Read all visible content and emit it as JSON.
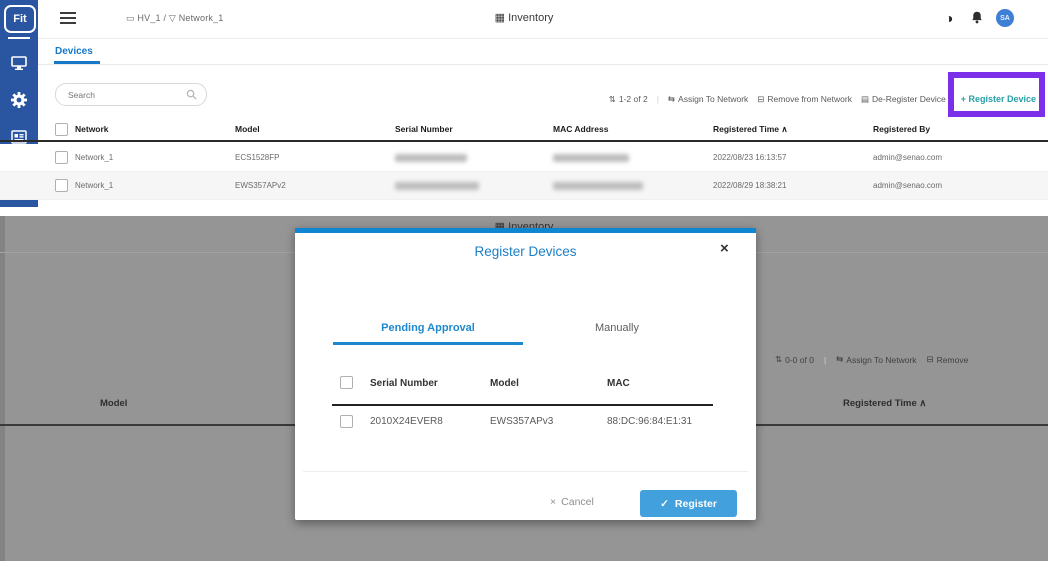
{
  "icons": {
    "sort": "⇅",
    "assign": "⇆",
    "remove": "⊟",
    "deregister": "▤",
    "contrast": "◑",
    "inventory": "▦",
    "breadcrumb_org": "▭",
    "breadcrumb_net": "▽",
    "check": "✓",
    "close": "×",
    "cancel_x": "×",
    "caret_up": "∧",
    "separator": "|"
  },
  "colors": {
    "sidebar_blue": "#2a55a0",
    "tab_blue": "#1878c8",
    "register_teal": "#269fa8",
    "highlight_purple": "#7c2fe8",
    "modal_blue": "#0f86d2",
    "title_blue": "#1c7fc6",
    "button_blue": "#42a0dc",
    "dim_overlay": "#969595",
    "avatar_blue": "#3f7fd6"
  },
  "sidebar": {
    "logo": "Fit"
  },
  "header": {
    "breadcrumb_org": "HV_1",
    "breadcrumb_separator": "/",
    "breadcrumb_network": "Network_1",
    "title": "Inventory",
    "avatar_initials": "SA"
  },
  "tabs": {
    "devices": "Devices"
  },
  "toolbar": {
    "search_placeholder": "Search",
    "count": "1-2 of 2",
    "assign": "Assign To Network",
    "remove": "Remove from Network",
    "deregister": "De-Register Device",
    "register": "+ Register Device"
  },
  "table": {
    "headers": {
      "network": "Network",
      "model": "Model",
      "serial": "Serial Number",
      "mac": "MAC Address",
      "time": "Registered Time",
      "by": "Registered By"
    },
    "sort_indicator": "∧",
    "rows": [
      {
        "network": "Network_1",
        "model": "ECS1528FP",
        "time": "2022/08/23 16:13:57",
        "by": "admin@senao.com"
      },
      {
        "network": "Network_1",
        "model": "EWS357APv2",
        "time": "2022/08/29 18:38:21",
        "by": "admin@senao.com"
      }
    ]
  },
  "background_page": {
    "title": "Inventory",
    "count": "0-0 of 0",
    "assign": "Assign To Network",
    "remove_partial": "Remove",
    "model_header": "Model",
    "time_header": "Registered Time",
    "sort_indicator": "∧"
  },
  "modal": {
    "title": "Register Devices",
    "tabs": {
      "pending": "Pending Approval",
      "manually": "Manually"
    },
    "table": {
      "headers": {
        "serial": "Serial Number",
        "model": "Model",
        "mac": "MAC"
      },
      "rows": [
        {
          "serial": "2010X24EVER8",
          "model": "EWS357APv3",
          "mac": "88:DC:96:84:E1:31"
        }
      ]
    },
    "cancel": "Cancel",
    "register": "Register"
  }
}
